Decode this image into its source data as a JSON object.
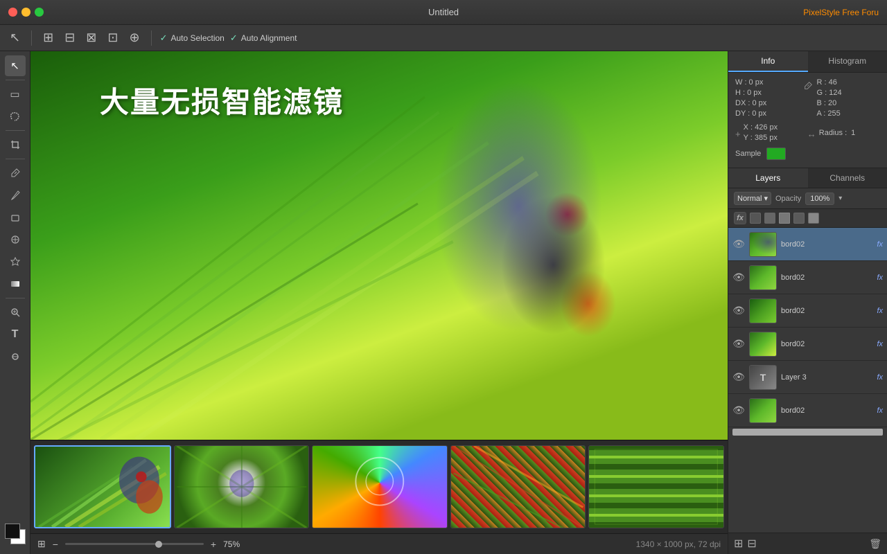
{
  "titlebar": {
    "title": "Untitled",
    "brand": "PixelStyle Free Foru"
  },
  "toolbar": {
    "auto_selection_label": "Auto Selection",
    "auto_alignment_label": "Auto Alignment",
    "auto_selection_checked": true,
    "auto_alignment_checked": true
  },
  "canvas": {
    "main_text": "大量无损智能滤镜",
    "zoom_level": "75%",
    "image_info": "1340 × 1000 px, 72 dpi"
  },
  "info_panel": {
    "tab_info": "Info",
    "tab_histogram": "Histogram",
    "w": "W : 0 px",
    "h": "H : 0 px",
    "dx": "DX : 0 px",
    "dy": "DY : 0 px",
    "r": "R : 46",
    "g": "G : 124",
    "b": "B : 20",
    "a": "A : 255",
    "x": "X : 426 px",
    "y": "Y : 385 px",
    "radius_label": "Radius :",
    "radius_val": "1",
    "sample_label": "Sample"
  },
  "layers_panel": {
    "tab_layers": "Layers",
    "tab_channels": "Channels",
    "blend_mode": "Normal",
    "opacity_label": "Opacity",
    "opacity_val": "100%",
    "layers": [
      {
        "name": "bord02",
        "visible": true,
        "active": true,
        "has_fx": true,
        "type": "image"
      },
      {
        "name": "bord02",
        "visible": true,
        "active": false,
        "has_fx": true,
        "type": "image"
      },
      {
        "name": "bord02",
        "visible": true,
        "active": false,
        "has_fx": true,
        "type": "image"
      },
      {
        "name": "bord02",
        "visible": true,
        "active": false,
        "has_fx": true,
        "type": "image"
      },
      {
        "name": "Layer 3",
        "visible": true,
        "active": false,
        "has_fx": true,
        "type": "text"
      },
      {
        "name": "bord02",
        "visible": true,
        "active": false,
        "has_fx": true,
        "type": "image"
      }
    ]
  },
  "filmstrip": {
    "thumbnails": [
      "thumb1",
      "thumb2",
      "thumb3",
      "thumb4",
      "thumb5"
    ]
  },
  "tools": {
    "move": "↖",
    "select_rect": "▭",
    "select_ellipse": "◌",
    "lasso": "⌇",
    "crop": "⌹",
    "eyedropper": "🖊",
    "brush": "🖌",
    "eraser": "◻",
    "clone": "◈",
    "heal": "⊕",
    "gradient": "▦",
    "zoom": "🔍",
    "text": "T",
    "zoom2": "⊕"
  }
}
